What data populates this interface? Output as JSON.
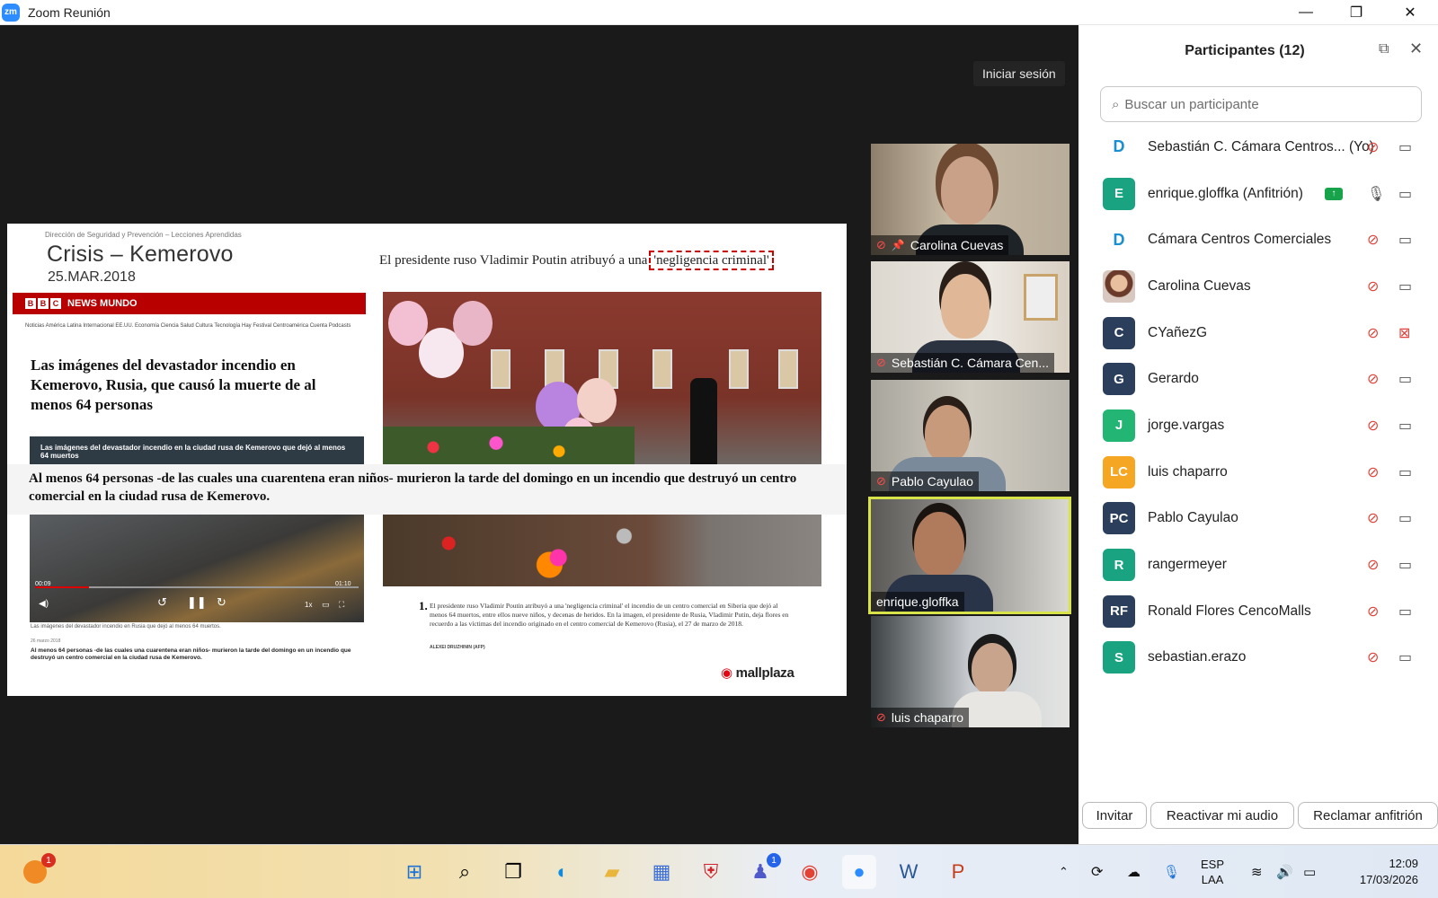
{
  "window": {
    "app_icon": "zm",
    "title": "Zoom Reunión",
    "minimize_icon": "—",
    "maximize_icon": "❐",
    "close_icon": "✕"
  },
  "meeting": {
    "signin_label": "Iniciar sesión"
  },
  "slide": {
    "crumb": "Dirección de Seguridad y Prevención – Lecciones Aprendidas",
    "title": "Crisis – Kemerovo",
    "date": "25.MAR.2018",
    "headline_prefix": "El presidente ruso Vladimir Poutin atribuyó a una",
    "headline_highlight": "'negligencia criminal'",
    "bbc_brand_b1": "B",
    "bbc_brand_b2": "B",
    "bbc_brand_c": "C",
    "bbc_section": "NEWS MUNDO",
    "bbc_nav": "Noticias   América Latina   Internacional   EE.UU.   Economía   Ciencia   Salud   Cultura   Tecnología   Hay Festival   Centroamérica Cuenta   Podcasts",
    "bbc_headline": "Las imágenes del devastador incendio en Kemerovo, Rusia, que causó la muerte de al menos 64 personas",
    "dark_caption": "Las imágenes del devastador incendio en la ciudad rusa de Kemerovo que dejó al menos 64 muertos",
    "overlay": "Al menos 64 personas -de las cuales una cuarentena eran niños- murieron la tarde del domingo en un incendio que destruyó un centro comercial en la ciudad rusa de Kemerovo.",
    "video_time_start": "00:09",
    "video_time_end": "01:10",
    "video_speed": "1x",
    "video_caption": "Las imágenes del devastador incendio en Rusia que dejó al menos 64 muertos.",
    "video_date": "26 marzo 2018",
    "video_body": "Al menos 64 personas -de las cuales una cuarentena eran niños- murieron la tarde del domingo en un incendio que destruyó un centro comercial en la ciudad rusa de Kemerovo.",
    "caption_num": "1.",
    "caption_body": "El presidente ruso Vladimir Poutin atribuyó a una 'negligencia criminal' el incendio de un centro comercial en Siberia que dejó al menos 64 muertos, entre ellos nueve niños, y decenas de heridos. En la imagen, el presidente de Rusia, Vladimir Putin, deja flores en recuerdo a las víctimas del incendio originado en el centro comercial de Kemerovo (Rusia), el 27 de marzo de 2018.",
    "caption_credit": "ALEXEI DRUZHININ (AFP)",
    "logo_mark": "◉",
    "logo_text": "mallplaza"
  },
  "tiles": [
    {
      "name": "Carolina Cuevas",
      "muted": true,
      "pinned": true
    },
    {
      "name": "Sebastián C. Cámara Cen...",
      "muted": true
    },
    {
      "name": "Pablo Cayulao",
      "muted": true
    },
    {
      "name": "enrique.gloffka",
      "muted": false,
      "active": true
    },
    {
      "name": "luis chaparro",
      "muted": true
    }
  ],
  "panel": {
    "title": "Participantes (12)",
    "search_placeholder": "Buscar un participante",
    "invite_label": "Invitar",
    "unmute_label": "Reactivar mi audio",
    "claim_host_label": "Reclamar anfitrión"
  },
  "participants": [
    {
      "initials": "D",
      "name": "Sebastián C. Cámara Centros... (Yo)",
      "avatar_type": "logo",
      "mic": "off",
      "cam": "on"
    },
    {
      "initials": "E",
      "name": "enrique.gloffka (Anfitrión)",
      "avatar_color": "#1aa380",
      "mic": "on",
      "cam": "on",
      "sharing": true
    },
    {
      "initials": "D",
      "name": "Cámara Centros Comerciales",
      "avatar_type": "logo",
      "mic": "off",
      "cam": "on"
    },
    {
      "initials": "",
      "name": "Carolina Cuevas",
      "avatar_type": "photo",
      "mic": "off",
      "cam": "on"
    },
    {
      "initials": "C",
      "name": "CYañezG",
      "avatar_color": "#2b3f5c",
      "mic": "off",
      "cam": "off"
    },
    {
      "initials": "G",
      "name": "Gerardo",
      "avatar_color": "#2b3f5c",
      "mic": "off",
      "cam": "on"
    },
    {
      "initials": "J",
      "name": "jorge.vargas",
      "avatar_color": "#22b573",
      "mic": "off",
      "cam": "on"
    },
    {
      "initials": "LC",
      "name": "luis chaparro",
      "avatar_color": "#f5a623",
      "mic": "off",
      "cam": "on"
    },
    {
      "initials": "PC",
      "name": "Pablo Cayulao",
      "avatar_color": "#2b3f5c",
      "mic": "off",
      "cam": "on"
    },
    {
      "initials": "R",
      "name": "rangermeyer",
      "avatar_color": "#1aa380",
      "mic": "off",
      "cam": "on"
    },
    {
      "initials": "RF",
      "name": "Ronald Flores CencoMalls",
      "avatar_color": "#2b3f5c",
      "mic": "off",
      "cam": "on"
    },
    {
      "initials": "S",
      "name": "sebastian.erazo",
      "avatar_color": "#1aa380",
      "mic": "off",
      "cam": "on"
    }
  ],
  "taskbar": {
    "notif_badge": "1",
    "teams_badge": "1",
    "lang_top": "ESP",
    "lang_bottom": "LAA",
    "time": "12:09",
    "date": "17/03/2026"
  }
}
